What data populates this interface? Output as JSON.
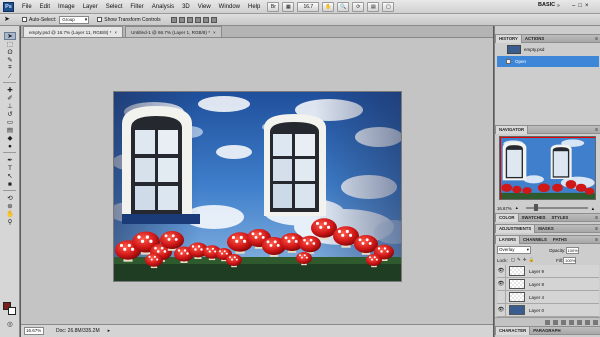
{
  "app": {
    "logo": "Ps",
    "menu": [
      "File",
      "Edit",
      "Image",
      "Layer",
      "Select",
      "Filter",
      "Analysis",
      "3D",
      "View",
      "Window",
      "Help"
    ],
    "zoom_popup": "16.7",
    "workspace": "BASIC",
    "window_buttons": [
      "–",
      "□",
      "×"
    ]
  },
  "options_bar": {
    "auto_select_label": "Auto-Select:",
    "auto_select_value": "Group",
    "show_transform_label": "Show Transform Controls"
  },
  "documents": {
    "tabs": [
      {
        "label": "empty.psd @ 16.7% (Layer 11, RGB/8) *",
        "close": "×"
      },
      {
        "label": "Untitled-1 @ 66.7% (Layer 1, RGB/8) *",
        "close": "×"
      }
    ]
  },
  "status_bar": {
    "zoom": "16.67%",
    "doc_info": "Doc: 26.8M/335.2M",
    "arrow": "▸"
  },
  "panels": {
    "history": {
      "tabs": [
        "HISTORY",
        "ACTIONS"
      ],
      "items": [
        {
          "label": "empty.psd",
          "selected": false
        },
        {
          "label": "Open",
          "selected": true
        }
      ]
    },
    "navigator": {
      "tabs": [
        "NAVIGATOR"
      ],
      "zoom": "16.67%"
    },
    "color": {
      "tabs": [
        "COLOR",
        "SWATCHES",
        "STYLES"
      ]
    },
    "adjustments": {
      "tabs": [
        "ADJUSTMENTS",
        "MASKS"
      ]
    },
    "layers": {
      "tabs": [
        "LAYERS",
        "CHANNELS",
        "PATHS"
      ],
      "blend_mode": "Overlay",
      "opacity_label": "Opacity:",
      "opacity_value": "100%",
      "lock_label": "Lock:",
      "fill_label": "Fill:",
      "fill_value": "100%",
      "rows": [
        {
          "name": "Layer 9",
          "visible": true
        },
        {
          "name": "Layer 8",
          "visible": true
        },
        {
          "name": "Layer 4",
          "visible": false
        },
        {
          "name": "Layer 0",
          "visible": true
        }
      ]
    },
    "character": {
      "tabs": [
        "CHARACTER",
        "PARAGRAPH"
      ]
    }
  },
  "colors": {
    "foreground": "#7b1f1a",
    "background": "#ffffff",
    "selection": "#3d86d8"
  }
}
